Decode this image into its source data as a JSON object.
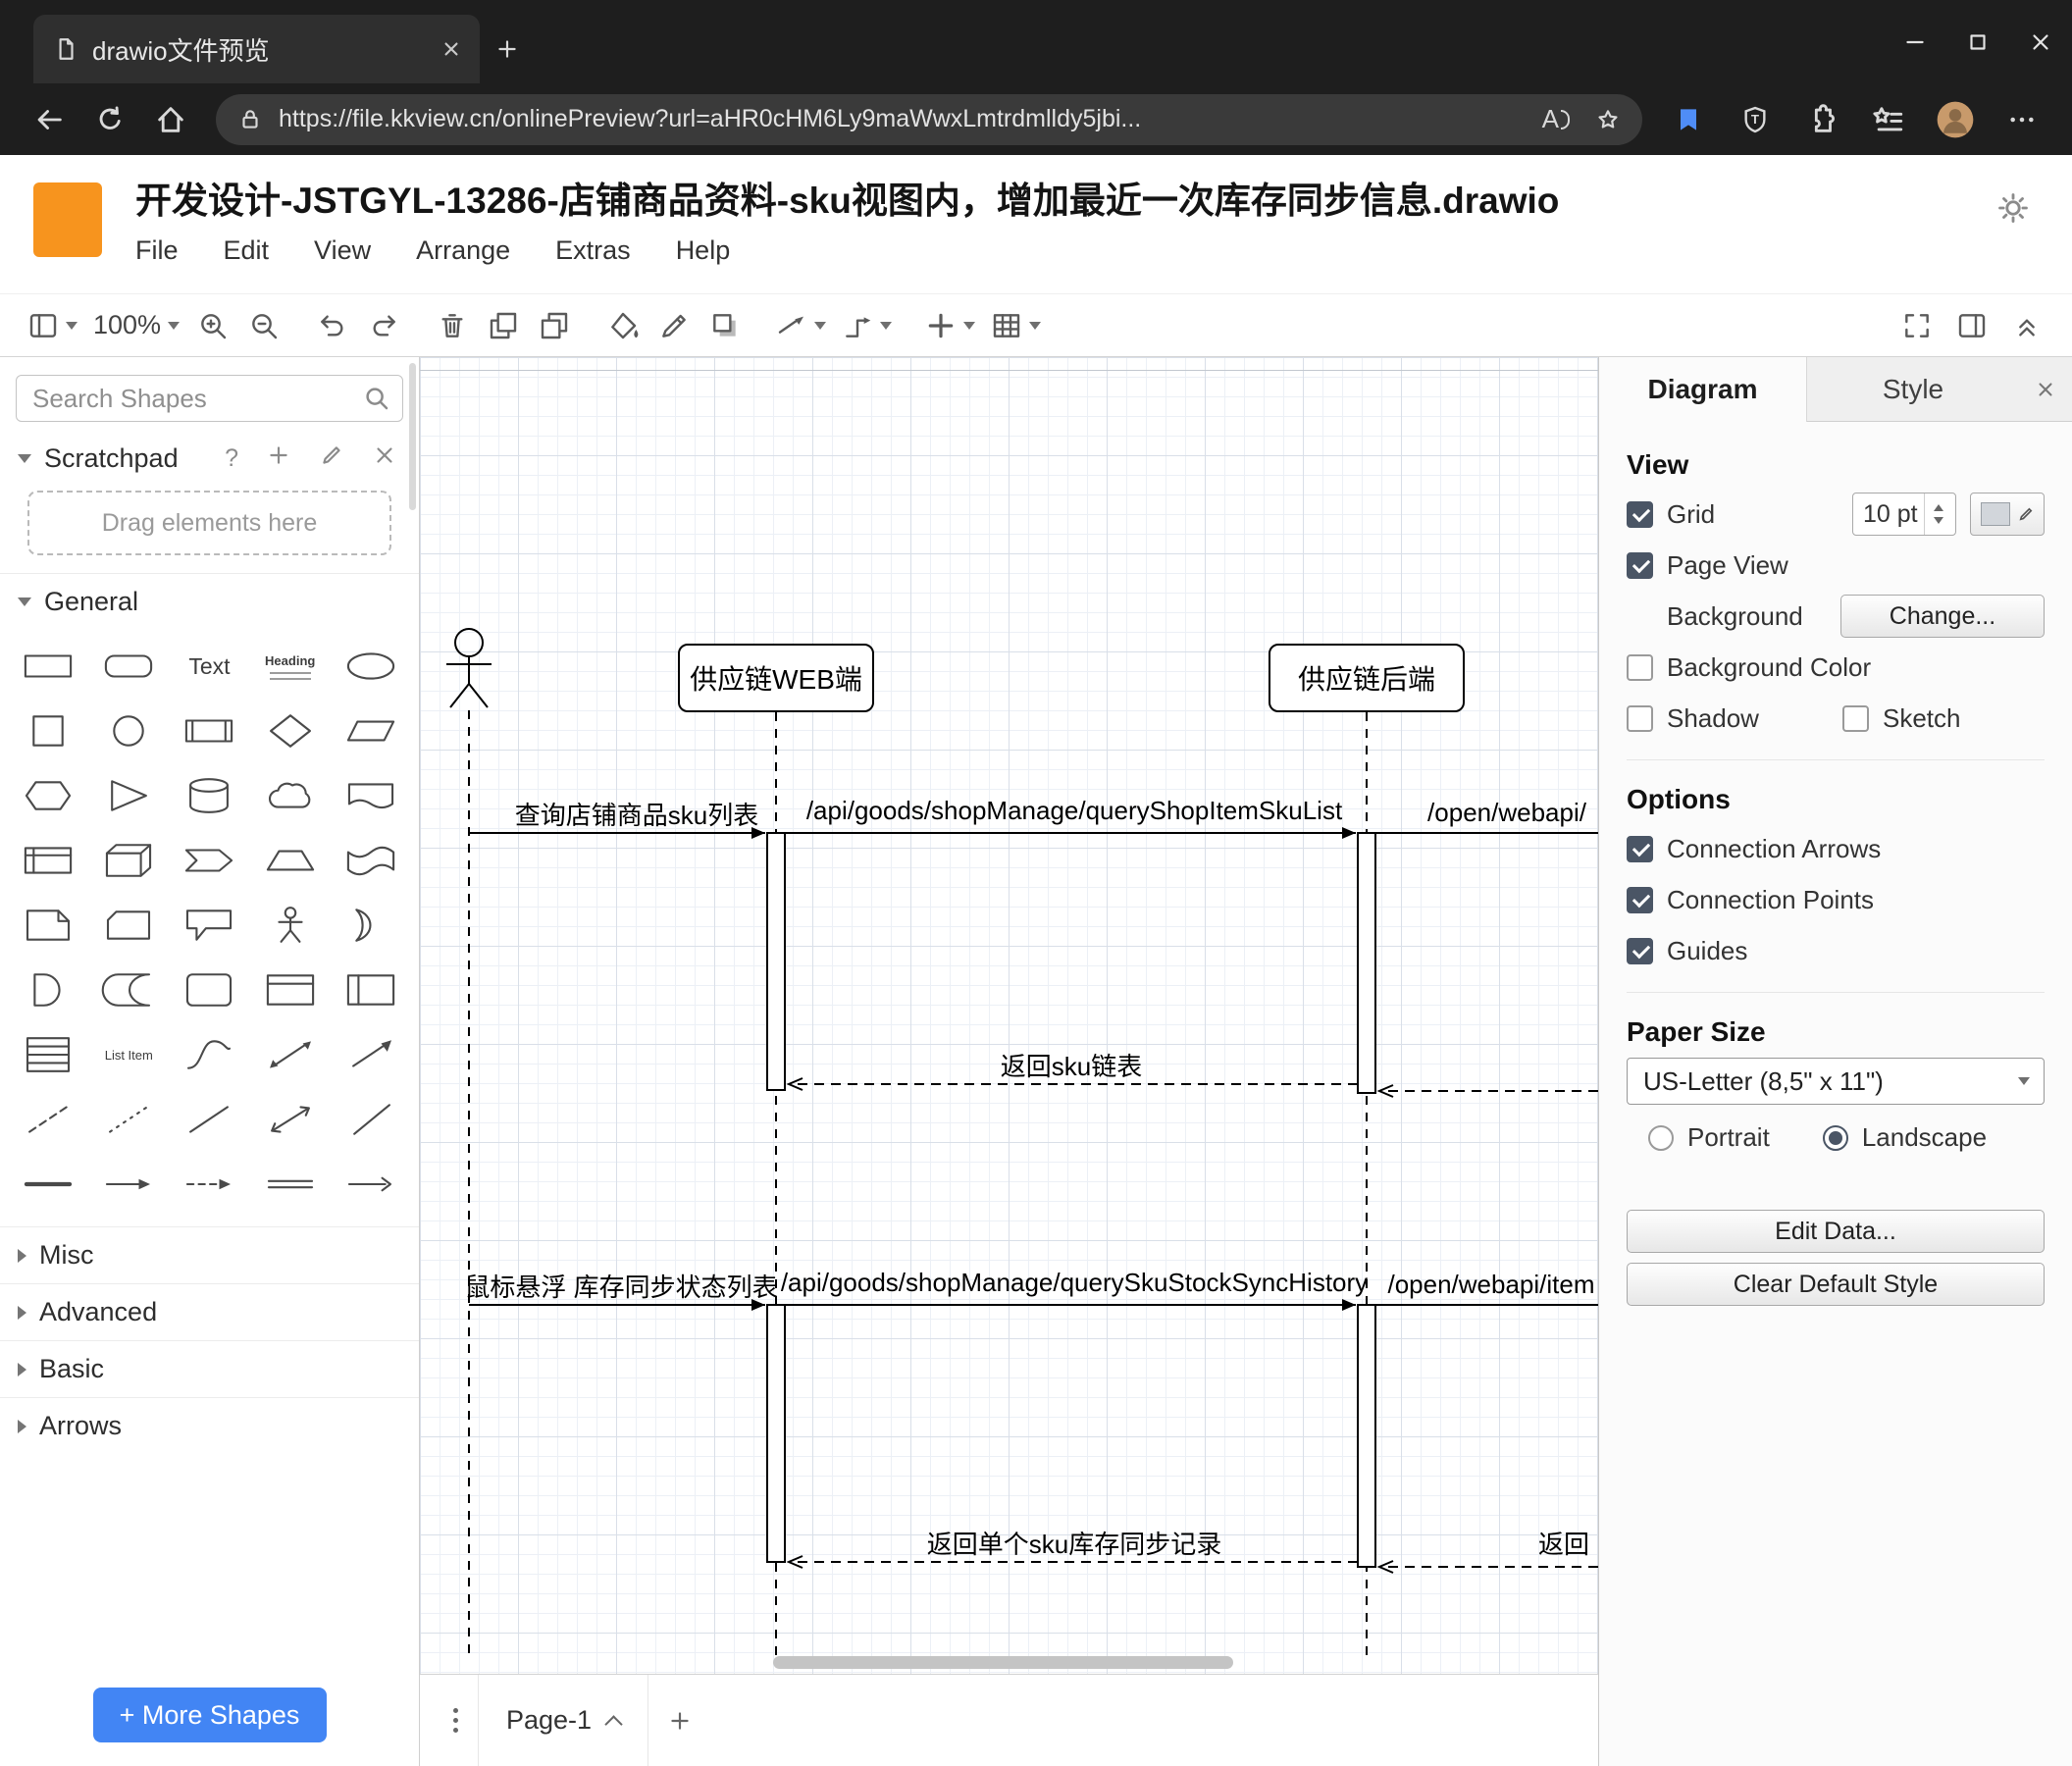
{
  "browser": {
    "tab_title": "drawio文件预览",
    "url": "https://file.kkview.cn/onlinePreview?url=aHR0cHM6Ly9maWwxLmtrdmlldy5jbi...",
    "read_aloud_label": "A",
    "shield_letter": "T"
  },
  "app": {
    "title": "开发设计-JSTGYL-13286-店铺商品资料-sku视图内，增加最近一次库存同步信息.drawio",
    "menus": [
      "File",
      "Edit",
      "View",
      "Arrange",
      "Extras",
      "Help"
    ],
    "zoom_level": "100%"
  },
  "sidebar": {
    "search_placeholder": "Search Shapes",
    "scratchpad_label": "Scratchpad",
    "scratchpad_help": "?",
    "dropzone_text": "Drag elements here",
    "general_label": "General",
    "sections": [
      "Misc",
      "Advanced",
      "Basic",
      "Arrows"
    ],
    "more_shapes_label": "+ More Shapes",
    "text_shape_label": "Text",
    "heading_shape_label": "Heading",
    "list_item_label": "List Item",
    "shapes": [
      "rectangle",
      "rounded-rectangle",
      "text",
      "heading",
      "ellipse",
      "square",
      "circle",
      "process",
      "diamond",
      "parallelogram",
      "hexagon",
      "triangle",
      "cylinder",
      "cloud",
      "document",
      "internal-storage",
      "cube",
      "step",
      "trapezoid",
      "tape",
      "note",
      "card",
      "callout",
      "actor",
      "or",
      "and",
      "data-storage",
      "container",
      "horizontal-container",
      "vertical-container",
      "list",
      "list-item",
      "curve",
      "bidirectional-arrow",
      "arrow",
      "dashed-line",
      "dotted-line",
      "line",
      "double-arrow",
      "diagonal-line",
      "horizontal-line",
      "arrow-edge",
      "dashed-edge",
      "link-edge",
      "directional-edge"
    ]
  },
  "canvas": {
    "lifelines": [
      "供应链WEB端",
      "供应链后端"
    ],
    "messages": {
      "m1": "查询店铺商品sku列表",
      "m1_api": "/api/goods/shopManage/queryShopItemSkuList",
      "m1_ext": "/open/webapi/",
      "m1_ret": "返回sku链表",
      "m2": "鼠标悬浮 库存同步状态列表",
      "m2_api": "/api/goods/shopManage/querySkuStockSyncHistory",
      "m2_ext": "/open/webapi/item",
      "m2_ret": "返回单个sku库存同步记录",
      "m2_ret_ext": "返回"
    }
  },
  "pagebar": {
    "page_label": "Page-1"
  },
  "panel": {
    "tab_diagram": "Diagram",
    "tab_style": "Style",
    "view_heading": "View",
    "grid_label": "Grid",
    "grid_size_value": "10 pt",
    "page_view_label": "Page View",
    "background_label": "Background",
    "change_button": "Change...",
    "background_color_label": "Background Color",
    "shadow_label": "Shadow",
    "sketch_label": "Sketch",
    "options_heading": "Options",
    "option_items": [
      "Connection Arrows",
      "Connection Points",
      "Guides"
    ],
    "paper_heading": "Paper Size",
    "paper_size_value": "US-Letter (8,5\" x 11\")",
    "portrait_label": "Portrait",
    "landscape_label": "Landscape",
    "edit_data_button": "Edit Data...",
    "clear_style_button": "Clear Default Style"
  },
  "colors": {
    "logo_orange": "#F7941E",
    "more_shapes_blue": "#4285f4",
    "checkbox_accent": "#4a5565"
  }
}
